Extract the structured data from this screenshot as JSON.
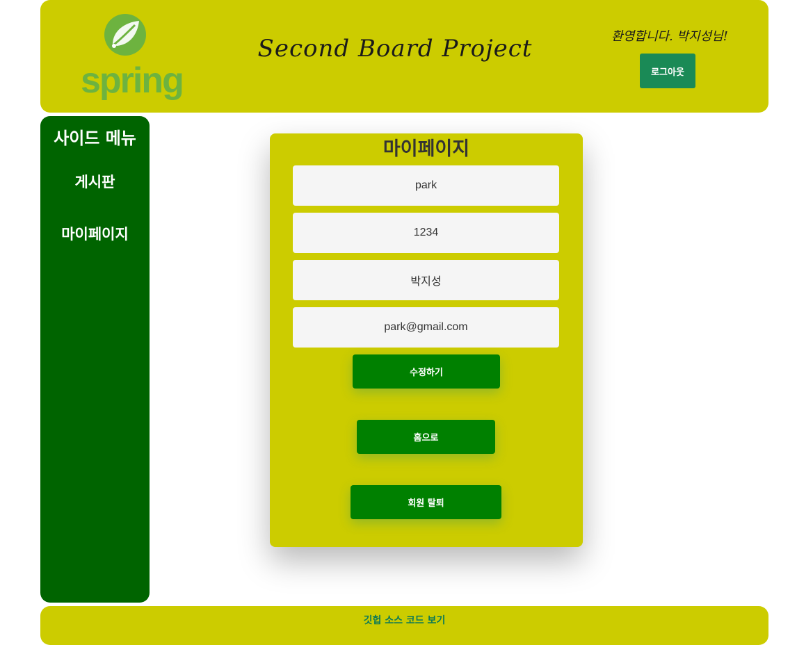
{
  "header": {
    "logo_text": "spring",
    "title": "Second Board Project",
    "welcome_text": "환영합니다. 박지성님!",
    "logout_label": "로그아웃"
  },
  "sidebar": {
    "title": "사이드 메뉴",
    "items": [
      {
        "label": "게시판"
      },
      {
        "label": "마이페이지"
      }
    ]
  },
  "mypage": {
    "title": "마이페이지",
    "fields": [
      {
        "value": "park"
      },
      {
        "value": "1234"
      },
      {
        "value": "박지성"
      },
      {
        "value": "park@gmail.com"
      }
    ],
    "edit_label": "수정하기",
    "home_label": "홈으로",
    "withdraw_label": "회원 탈퇴"
  },
  "footer": {
    "link_label": "깃헙 소스 코드 보기"
  },
  "colors": {
    "header_bg": "#cccc00",
    "sidebar_bg": "#006400",
    "button_green": "#008000",
    "logout_green": "#1a8a56",
    "spring_green": "#6db33f"
  },
  "icons": {
    "logo": "spring-leaf-icon"
  }
}
